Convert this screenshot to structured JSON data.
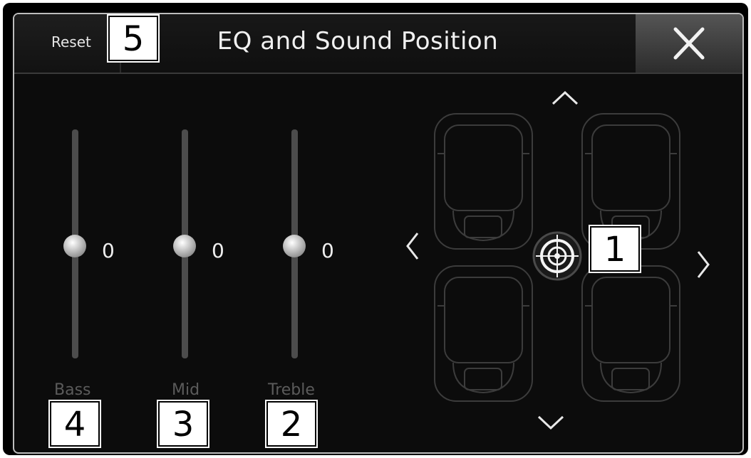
{
  "header": {
    "reset_label": "Reset",
    "title": "EQ and Sound Position",
    "close_icon": "close-icon"
  },
  "equalizer": [
    {
      "label": "Bass",
      "value": "0"
    },
    {
      "label": "Mid",
      "value": "0"
    },
    {
      "label": "Treble",
      "value": "0"
    }
  ],
  "sound_position": {
    "icons": [
      "chevron-up-icon",
      "chevron-down-icon",
      "chevron-left-icon",
      "chevron-right-icon",
      "target-crosshair-icon",
      "seat-icon"
    ]
  },
  "callouts": {
    "one": "1",
    "two": "2",
    "three": "3",
    "four": "4",
    "five": "5"
  },
  "colors": {
    "background": "#0c0c0c",
    "text": "#f0f0f0",
    "muted_label": "#5b5b5b",
    "track": "#4c4c4c"
  }
}
